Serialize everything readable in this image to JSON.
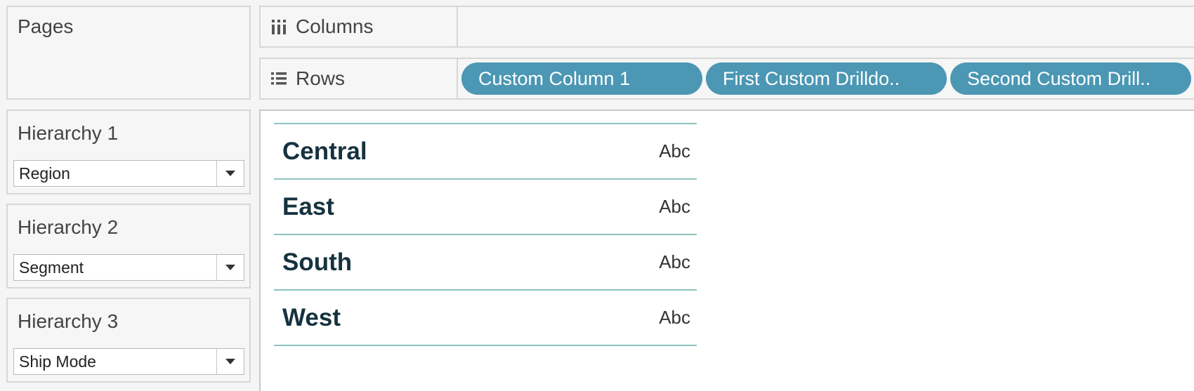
{
  "pages": {
    "title": "Pages"
  },
  "filters": [
    {
      "title": "Hierarchy 1",
      "value": "Region"
    },
    {
      "title": "Hierarchy 2",
      "value": "Segment"
    },
    {
      "title": "Hierarchy 3",
      "value": "Ship Mode"
    }
  ],
  "columns_shelf": {
    "label": "Columns",
    "icon": "columns-icon"
  },
  "rows_shelf": {
    "label": "Rows",
    "icon": "rows-icon",
    "pills": [
      "Custom Column 1",
      "First Custom Drilldo..",
      "Second Custom Drill.."
    ]
  },
  "table": {
    "rows": [
      {
        "header": "Central",
        "value": "Abc"
      },
      {
        "header": "East",
        "value": "Abc"
      },
      {
        "header": "South",
        "value": "Abc"
      },
      {
        "header": "West",
        "value": "Abc"
      }
    ]
  },
  "colors": {
    "pill": "#4b97b4",
    "row_divider": "#8fc4c0",
    "header_text": "#15323f"
  }
}
